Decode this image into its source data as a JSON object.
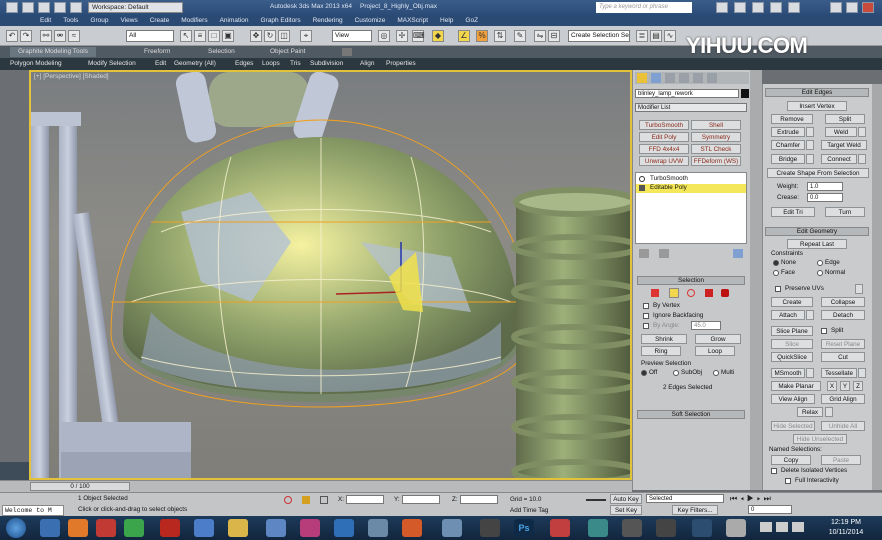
{
  "title_bar": {
    "workspace": "Workspace: Default",
    "app_title": "Autodesk 3ds Max 2013 x64",
    "file_title": "Project_8_Highly_Obj.max",
    "search_placeholder": "Type a keyword or phrase"
  },
  "menu": [
    "Edit",
    "Tools",
    "Group",
    "Views",
    "Create",
    "Modifiers",
    "Animation",
    "Graph Editors",
    "Rendering",
    "Customize",
    "MAXScript",
    "Help",
    "GoZ"
  ],
  "toolbar": {
    "selection_filter": "All",
    "view": "View",
    "named_selection": "Create Selection Se"
  },
  "ribbon_tabs": [
    "Graphite Modeling Tools",
    "Freeform",
    "Selection",
    "Object Paint"
  ],
  "ribbon_items": [
    "Polygon Modeling",
    "Modify Selection",
    "Edit",
    "Geometry (All)",
    "Edges",
    "Loops",
    "Tris",
    "Subdivision",
    "Align",
    "Properties"
  ],
  "watermark": "YIHUU.COM",
  "viewport": {
    "label": "[+] [Perspective] [Shaded]"
  },
  "command_panel": {
    "object_name": "blinley_lamp_rework",
    "modifier_list": "Modifier List",
    "modifier_buttons": [
      "TurboSmooth",
      "Shell",
      "Edit Poly",
      "Symmetry",
      "FFD 4x4x4",
      "STL Check",
      "Unwrap UVW",
      "FFDeform (WS)"
    ],
    "stack": [
      "TurboSmooth",
      "Editable Poly"
    ],
    "selection": {
      "title": "Selection",
      "by_vertex": "By Vertex",
      "ignore_backfacing": "Ignore Backfacing",
      "by_angle": "By Angle:",
      "angle_value": "45.0",
      "shrink": "Shrink",
      "grow": "Grow",
      "ring": "Ring",
      "loop": "Loop",
      "preview_title": "Preview Selection",
      "off": "Off",
      "subobj": "SubObj",
      "multi": "Multi",
      "status": "2 Edges Selected"
    },
    "soft_selection": "Soft Selection"
  },
  "edit_edges": {
    "title": "Edit Edges",
    "insert_vertex": "Insert Vertex",
    "remove": "Remove",
    "split": "Split",
    "extrude": "Extrude",
    "weld": "Weld",
    "chamfer": "Chamfer",
    "target_weld": "Target Weld",
    "bridge": "Bridge",
    "connect": "Connect",
    "create_shape": "Create Shape From Selection",
    "weight_label": "Weight:",
    "weight_value": "1.0",
    "crease_label": "Crease:",
    "crease_value": "0.0",
    "edit_tri": "Edit Tri",
    "turn": "Turn"
  },
  "edit_geometry": {
    "title": "Edit Geometry",
    "repeat_last": "Repeat Last",
    "constraints": "Constraints",
    "none": "None",
    "edge": "Edge",
    "face": "Face",
    "normal": "Normal",
    "preserve_uvs": "Preserve UVs",
    "create": "Create",
    "collapse": "Collapse",
    "attach": "Attach",
    "detach": "Detach",
    "slice_plane": "Slice Plane",
    "split": "Split",
    "slice": "Slice",
    "reset_plane": "Reset Plane",
    "quickslice": "QuickSlice",
    "cut": "Cut",
    "msmooth": "MSmooth",
    "tessellate": "Tessellate",
    "make_planar": "Make Planar",
    "x": "X",
    "y": "Y",
    "z": "Z",
    "view_align": "View Align",
    "grid_align": "Grid Align",
    "relax": "Relax",
    "hide_selected": "Hide Selected",
    "unhide_all": "Unhide All",
    "hide_unselected": "Hide Unselected",
    "named_selections": "Named Selections:",
    "copy": "Copy",
    "paste": "Paste",
    "delete_isolated": "Delete Isolated Vertices",
    "full_interactivity": "Full Interactivity"
  },
  "timeline": {
    "frame": "0 / 100"
  },
  "status": {
    "objects": "1 Object Selected",
    "prompt": "Click or click-and-drag to select objects",
    "x_label": "X:",
    "y_label": "Y:",
    "z_label": "Z:",
    "grid": "Grid = 10.0",
    "auto_key": "Auto Key",
    "set_key": "Set Key",
    "key_mode": "Selected",
    "key_filters": "Key Filters...",
    "add_time_tag": "Add Time Tag",
    "frame_value": "0"
  },
  "welcome": "Welcome to M",
  "clock": {
    "time": "12:19 PM",
    "date": "10/11/2014"
  }
}
